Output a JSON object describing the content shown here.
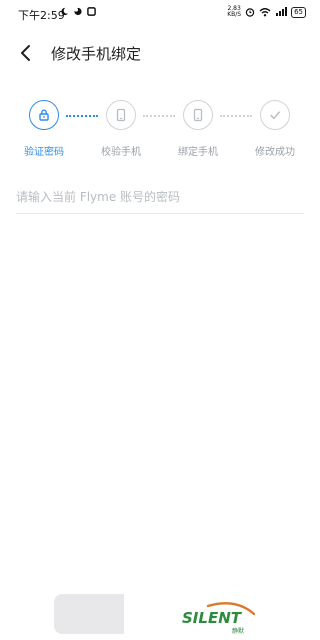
{
  "status_bar": {
    "time": "下午2:59",
    "net_speed_value": "2.83",
    "net_speed_unit": "KB/S",
    "battery": "65"
  },
  "header": {
    "back_icon": "chevron-left-icon",
    "title": "修改手机绑定"
  },
  "steps": [
    {
      "label": "验证密码",
      "icon": "lock-icon",
      "active": true
    },
    {
      "label": "校验手机",
      "icon": "phone-icon",
      "active": false
    },
    {
      "label": "绑定手机",
      "icon": "phone-icon",
      "active": false
    },
    {
      "label": "修改成功",
      "icon": "check-icon",
      "active": false
    }
  ],
  "password": {
    "value": "",
    "placeholder": "请输入当前 Flyme 账号的密码"
  },
  "colors": {
    "accent": "#2d8cf0",
    "inactive": "#cfd3d8",
    "watermark_green": "#2e8b3e",
    "watermark_orange": "#d9792b"
  },
  "watermark": {
    "text": "SILENT",
    "sub": "静默"
  }
}
